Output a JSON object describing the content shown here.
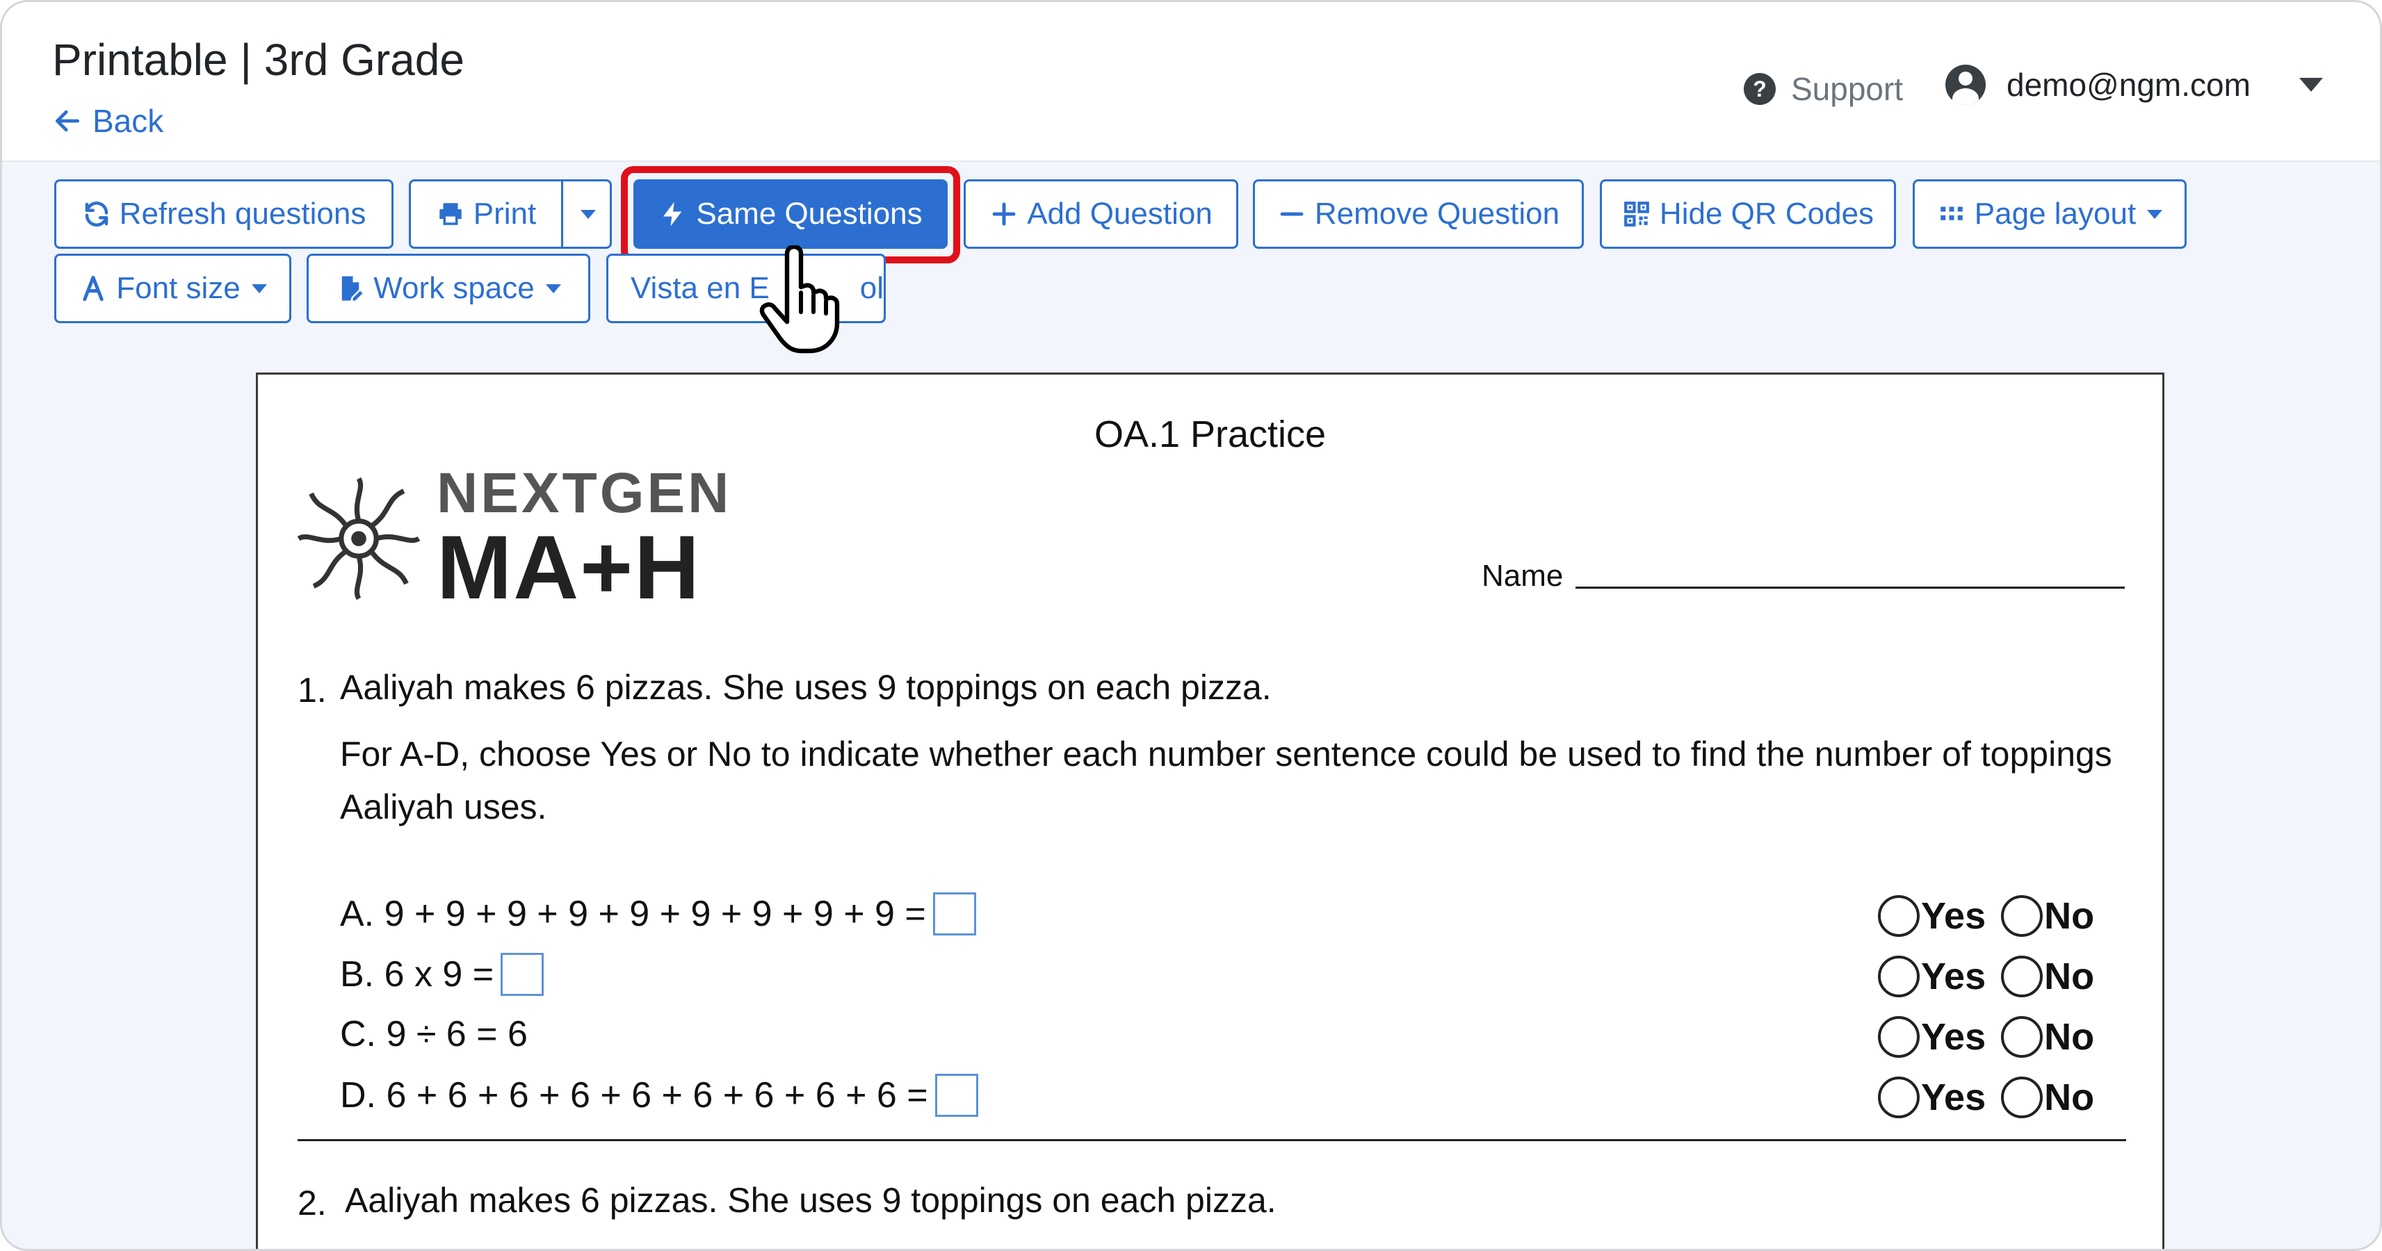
{
  "header": {
    "title": "Printable | 3rd Grade",
    "back_label": "Back",
    "support_label": "Support",
    "user_email": "demo@ngm.com"
  },
  "toolbar": {
    "refresh": "Refresh questions",
    "print": "Print",
    "same_questions": "Same Questions",
    "add_question": "Add Question",
    "remove_question": "Remove Question",
    "hide_qr": "Hide QR Codes",
    "page_layout": "Page layout",
    "font_size": "Font size",
    "work_space": "Work space",
    "vista": "Vista en E",
    "vista_tail": "ol"
  },
  "worksheet": {
    "title": "OA.1 Practice",
    "logo_top": "NEXTGEN",
    "logo_bottom": "MA+H",
    "name_label": "Name",
    "q1": {
      "number": "1.",
      "text": "Aaliyah makes 6 pizzas. She uses 9 toppings on each pizza.",
      "instructions": "For A-D, choose Yes or No to indicate whether each number sentence could be used to find the number of toppings Aaliyah uses.",
      "options": [
        {
          "text": "A. 9 + 9 + 9 + 9 + 9 + 9 + 9 + 9 + 9 ="
        },
        {
          "text": "B. 6 x 9 ="
        },
        {
          "text": "C. 9 ÷ 6 = 6"
        },
        {
          "text": "D. 6 + 6 + 6 + 6 + 6 + 6 + 6 + 6 + 6 ="
        }
      ],
      "yes_label": "Yes",
      "no_label": "No"
    },
    "q2": {
      "number": "2.",
      "text": "Aaliyah makes 6 pizzas. She uses 9 toppings on each pizza."
    }
  },
  "colors": {
    "accent": "#2c6fd1",
    "highlight": "#e0101b"
  }
}
